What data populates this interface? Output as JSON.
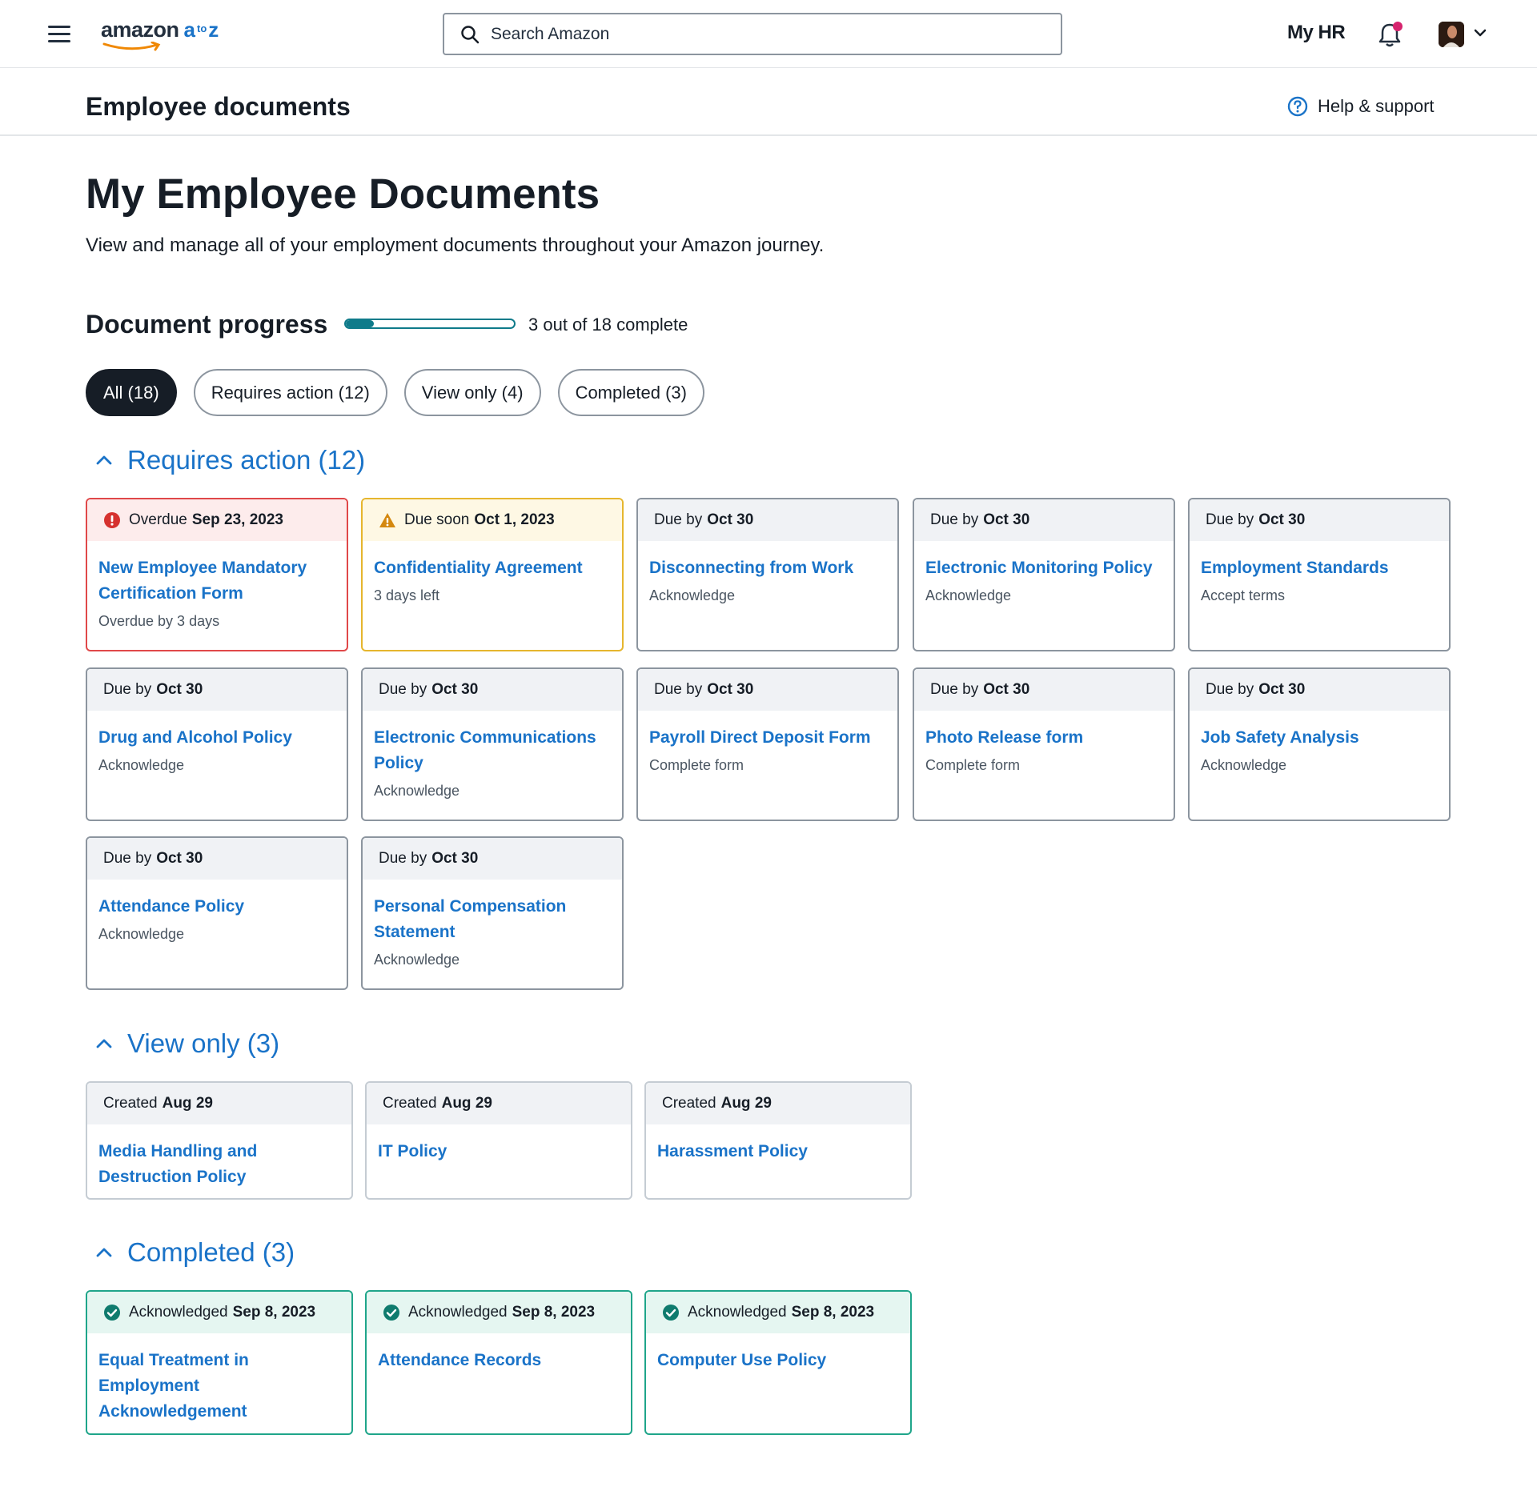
{
  "nav": {
    "logo_word": "amazon",
    "logo_a": "a",
    "logo_to": "to",
    "logo_z": "z",
    "search_placeholder": "Search Amazon",
    "myhr": "My HR"
  },
  "subheader": {
    "title": "Employee documents",
    "help": "Help & support"
  },
  "page": {
    "title": "My Employee Documents",
    "description": "View and manage all of your employment documents throughout your Amazon journey."
  },
  "progress": {
    "title": "Document progress",
    "text": "3 out of 18 complete",
    "completed": 3,
    "total": 18
  },
  "filters": [
    {
      "label": "All (18)",
      "active": true
    },
    {
      "label": "Requires action (12)",
      "active": false
    },
    {
      "label": "View only (4)",
      "active": false
    },
    {
      "label": "Completed (3)",
      "active": false
    }
  ],
  "sections": {
    "requires_action": {
      "label": "Requires action (12)",
      "cards": [
        {
          "status_prefix": "Overdue",
          "status_date": "Sep 23, 2023",
          "title": "New Employee Mandatory Certification Form",
          "subtitle": "Overdue by 3 days",
          "kind": "overdue"
        },
        {
          "status_prefix": "Due soon",
          "status_date": "Oct 1, 2023",
          "title": "Confidentiality Agreement",
          "subtitle": "3 days left",
          "kind": "soon"
        },
        {
          "status_prefix": "Due by",
          "status_date": "Oct 30",
          "title": "Disconnecting from Work",
          "subtitle": "Acknowledge",
          "kind": "normal"
        },
        {
          "status_prefix": "Due by",
          "status_date": "Oct 30",
          "title": "Electronic Monitoring Policy",
          "subtitle": "Acknowledge",
          "kind": "normal"
        },
        {
          "status_prefix": "Due by",
          "status_date": "Oct 30",
          "title": "Employment Standards",
          "subtitle": "Accept terms",
          "kind": "normal"
        },
        {
          "status_prefix": "Due by",
          "status_date": "Oct 30",
          "title": "Drug and Alcohol Policy",
          "subtitle": "Acknowledge",
          "kind": "normal"
        },
        {
          "status_prefix": "Due by",
          "status_date": "Oct 30",
          "title": "Electronic Communications Policy",
          "subtitle": "Acknowledge",
          "kind": "normal"
        },
        {
          "status_prefix": "Due by",
          "status_date": "Oct 30",
          "title": "Payroll Direct Deposit Form",
          "subtitle": "Complete form",
          "kind": "normal"
        },
        {
          "status_prefix": "Due by",
          "status_date": "Oct 30",
          "title": "Photo Release form",
          "subtitle": "Complete form",
          "kind": "normal"
        },
        {
          "status_prefix": "Due by",
          "status_date": "Oct 30",
          "title": "Job Safety Analysis",
          "subtitle": "Acknowledge",
          "kind": "normal"
        },
        {
          "status_prefix": "Due by",
          "status_date": "Oct 30",
          "title": "Attendance Policy",
          "subtitle": "Acknowledge",
          "kind": "normal"
        },
        {
          "status_prefix": "Due by",
          "status_date": "Oct 30",
          "title": "Personal Compensation Statement",
          "subtitle": "Acknowledge",
          "kind": "normal"
        }
      ]
    },
    "view_only": {
      "label": "View only (3)",
      "cards": [
        {
          "status_prefix": "Created",
          "status_date": "Aug 29",
          "title": "Media Handling and Destruction Policy"
        },
        {
          "status_prefix": "Created",
          "status_date": "Aug 29",
          "title": "IT Policy"
        },
        {
          "status_prefix": "Created",
          "status_date": "Aug 29",
          "title": "Harassment Policy"
        }
      ]
    },
    "completed": {
      "label": "Completed (3)",
      "cards": [
        {
          "status_prefix": "Acknowledged",
          "status_date": "Sep 8, 2023",
          "title": "Equal Treatment in Employment Acknowledgement"
        },
        {
          "status_prefix": "Acknowledged",
          "status_date": "Sep 8, 2023",
          "title": "Attendance Records"
        },
        {
          "status_prefix": "Acknowledged",
          "status_date": "Sep 8, 2023",
          "title": "Computer Use Policy"
        }
      ]
    }
  },
  "colors": {
    "link": "#1a73c8",
    "overdue": "#e04849",
    "soon": "#e6b62e",
    "done": "#1fa58a",
    "progress": "#0f7b8a",
    "notification_dot": "#d6246e"
  }
}
